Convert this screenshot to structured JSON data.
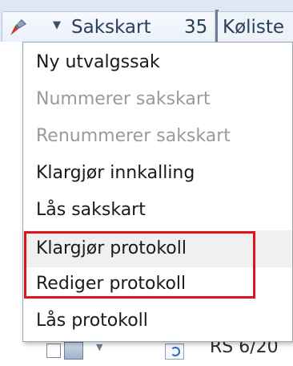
{
  "tabs": {
    "active_label": "Sakskart",
    "active_count": "35",
    "next_label": "Køliste"
  },
  "background_row": {
    "text": "RS  6/20"
  },
  "menu": {
    "items": [
      {
        "label": "Ny utvalgssak",
        "enabled": true
      },
      {
        "label": "Nummerer sakskart",
        "enabled": false
      },
      {
        "label": "Renummerer sakskart",
        "enabled": false
      },
      {
        "label": "Klargjør innkalling",
        "enabled": true
      },
      {
        "label": "Lås sakskart",
        "enabled": true
      },
      {
        "label": "Klargjør protokoll",
        "enabled": true
      },
      {
        "label": "Rediger protokoll",
        "enabled": true
      },
      {
        "label": "Lås protokoll",
        "enabled": true
      }
    ]
  },
  "colors": {
    "highlight_border": "#e0121c",
    "disabled_text": "#9a9a9a",
    "menu_border": "#9aa7b5"
  }
}
